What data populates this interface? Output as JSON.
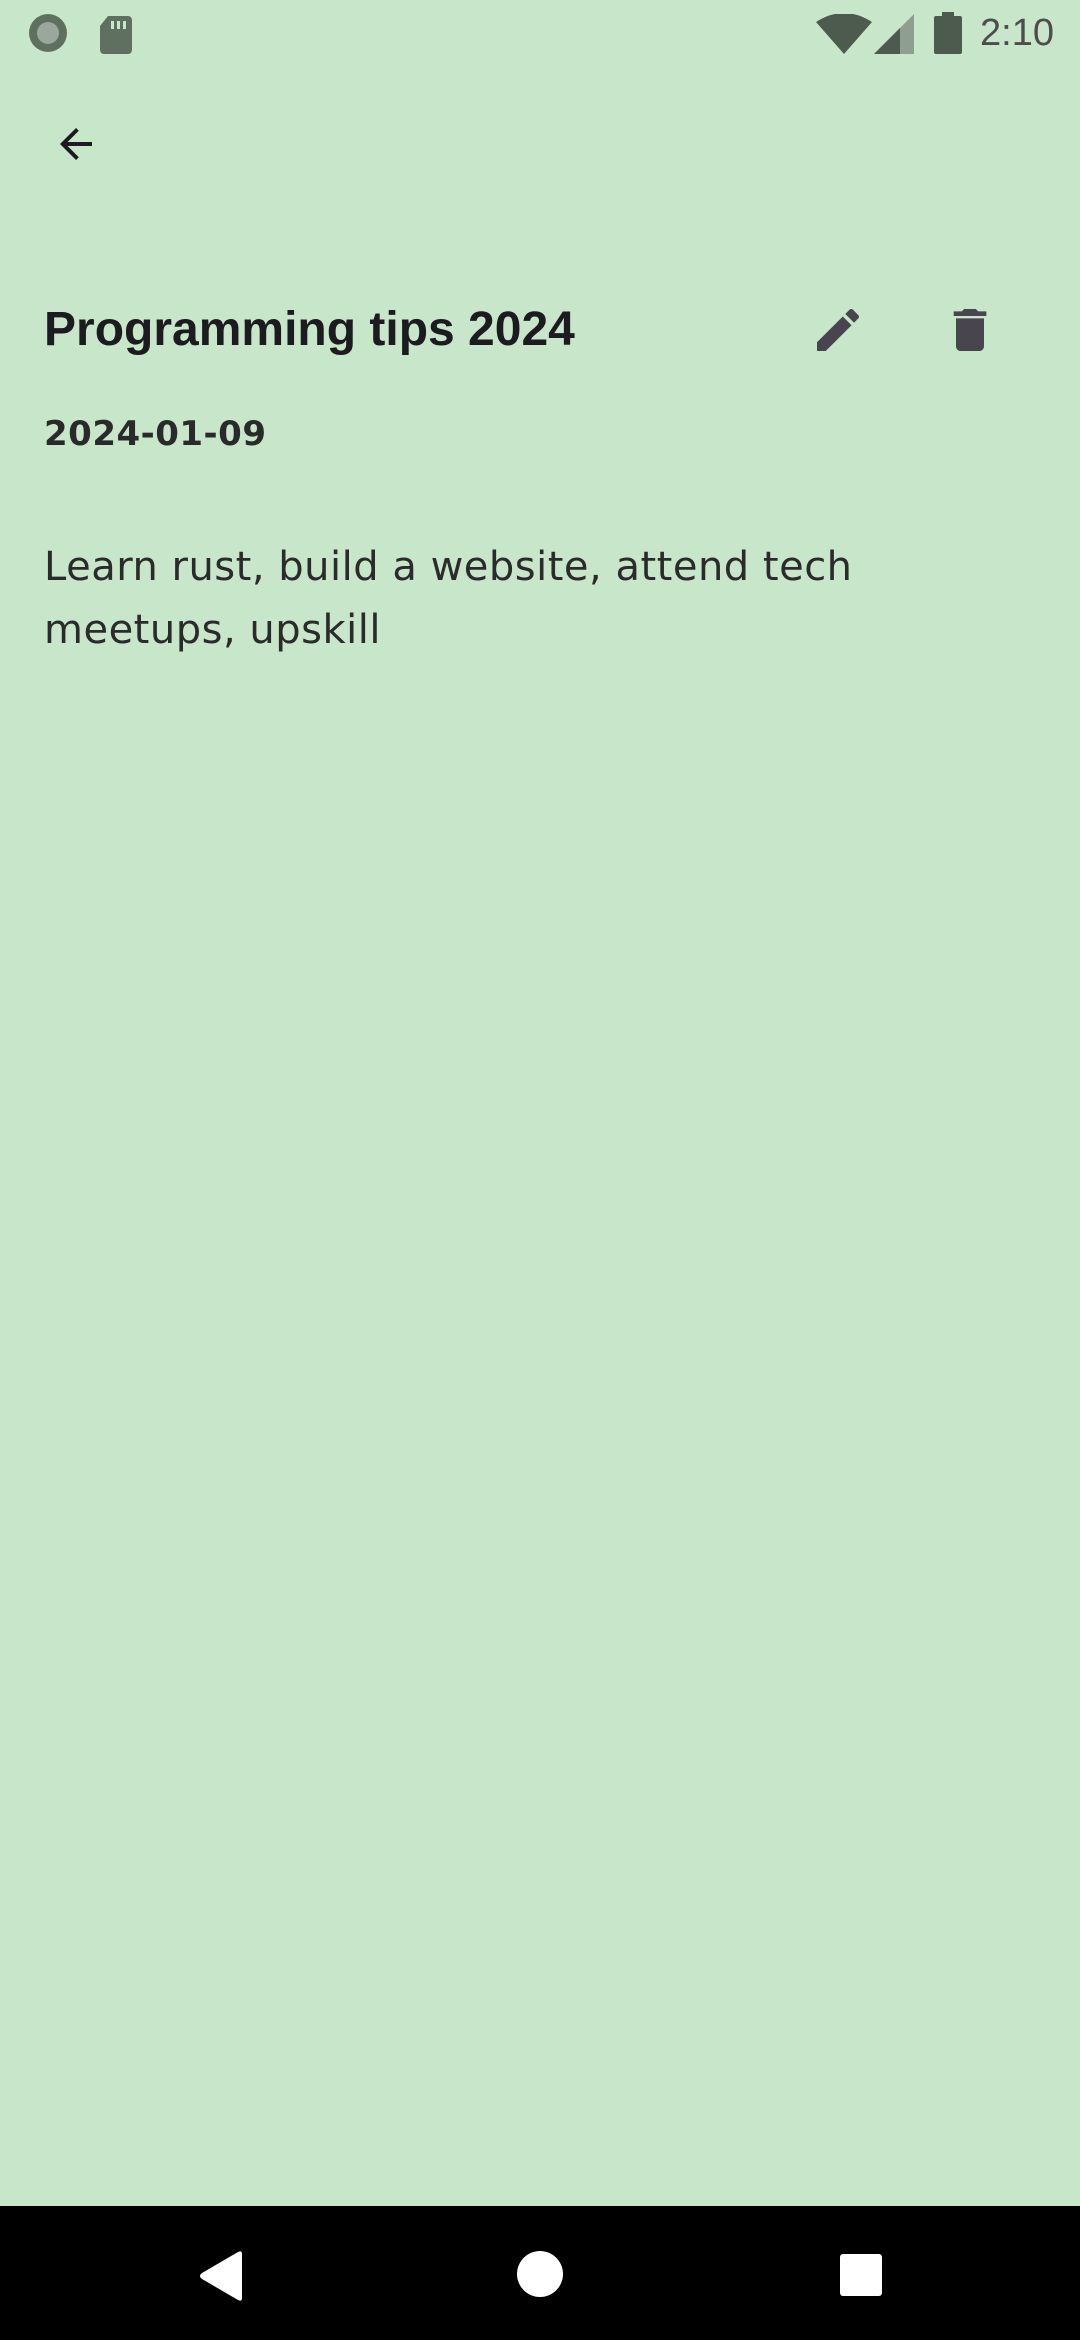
{
  "status_bar": {
    "time": "2:10",
    "icons": [
      "notification-circle-icon",
      "sd-card-icon",
      "wifi-icon",
      "cell-signal-icon",
      "battery-icon"
    ]
  },
  "app_bar": {
    "back_icon": "arrow-back-icon"
  },
  "note": {
    "title": "Programming tips 2024",
    "date": "2024-01-09",
    "body": "Learn rust, build a website, attend tech meetups, upskill",
    "edit_icon": "pencil-icon",
    "delete_icon": "trash-icon"
  },
  "nav_bar": {
    "icons": [
      "nav-back-icon",
      "nav-home-icon",
      "nav-recents-icon"
    ]
  },
  "colors": {
    "background": "#c8e6c9",
    "icon": "#49454f",
    "text": "#1c1b1f",
    "nav_bar": "#000000"
  }
}
